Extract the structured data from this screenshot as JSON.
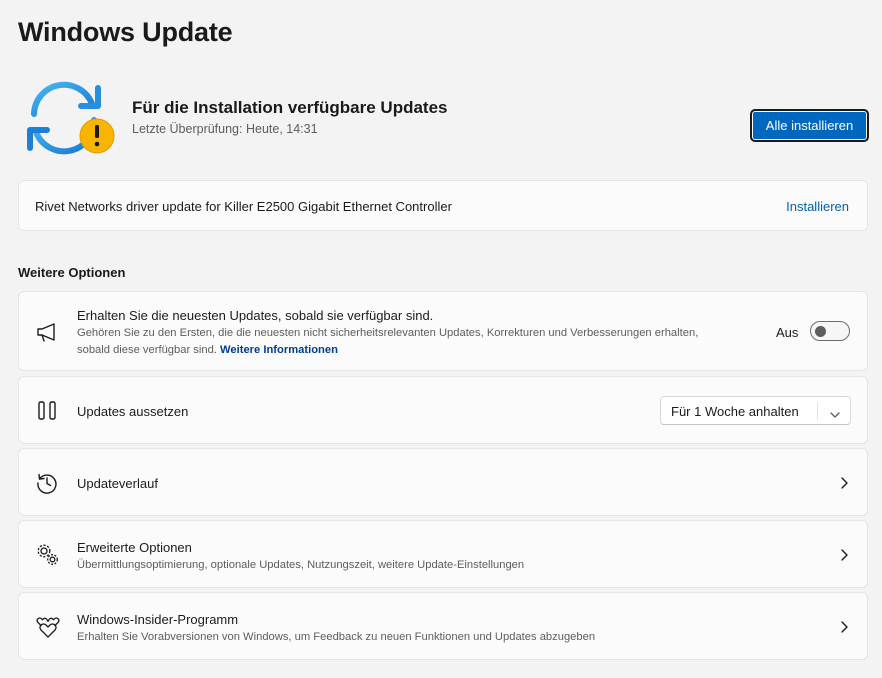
{
  "page": {
    "title": "Windows Update"
  },
  "status": {
    "title": "Für die Installation verfügbare Updates",
    "subtitle": "Letzte Überprüfung: Heute, 14:31",
    "install_all_label": "Alle installieren",
    "icon": "sync-warning-icon",
    "accent_color": "#0067c0",
    "warning_color": "#f7b400"
  },
  "pending_update": {
    "name": "Rivet Networks driver update for Killer E2500 Gigabit Ethernet Controller",
    "action_label": "Installieren"
  },
  "more_options": {
    "title": "Weitere Optionen",
    "items": [
      {
        "icon": "megaphone-icon",
        "title": "Erhalten Sie die neuesten Updates, sobald sie verfügbar sind.",
        "description_line1": "Gehören Sie zu den Ersten, die die neuesten nicht sicherheitsrelevanten Updates, Korrekturen und Verbesserungen erhalten,",
        "description_line2": "sobald diese verfügbar sind.",
        "link_label": "Weitere Informationen",
        "toggle_label": "Aus",
        "toggle_on": false
      },
      {
        "icon": "pause-icon",
        "title": "Updates aussetzen",
        "dropdown_value": "Für 1 Woche anhalten"
      },
      {
        "icon": "history-icon",
        "title": "Updateverlauf"
      },
      {
        "icon": "gears-icon",
        "title": "Erweiterte Optionen",
        "description": "Übermittlungsoptimierung, optionale Updates, Nutzungszeit, weitere Update-Einstellungen"
      },
      {
        "icon": "insider-hearts-icon",
        "title": "Windows-Insider-Programm",
        "description": "Erhalten Sie Vorabversionen von Windows, um Feedback zu neuen Funktionen und Updates abzugeben"
      }
    ]
  }
}
